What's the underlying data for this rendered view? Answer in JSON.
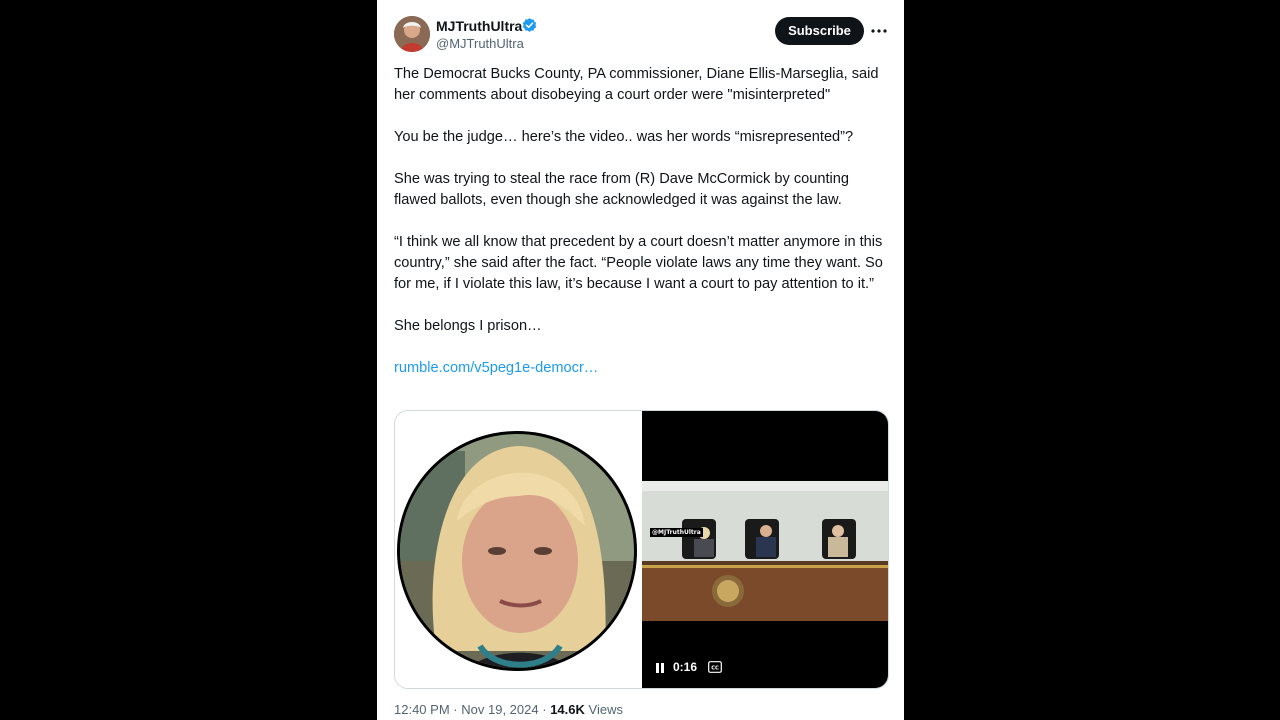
{
  "author": {
    "name": "MJTruthUltra",
    "handle": "@MJTruthUltra",
    "verified": true,
    "verified_color": "#1d9bf0"
  },
  "header": {
    "subscribe_label": "Subscribe",
    "more_icon": "more-horizontal-icon"
  },
  "tweet": {
    "paragraphs": [
      "The Democrat Bucks County, PA commissioner, Diane Ellis-Marseglia, said her comments about disobeying a court order were \"misinterpreted\"",
      "You be the judge… here’s the video.. was her words “misrepresented”?",
      "She was trying to steal the race from (R) Dave McCormick by counting flawed ballots, even though she acknowledged it was against the law.",
      "“I think we all know that precedent by a court doesn’t matter anymore in this country,” she said after the fact. “People violate laws any time they want. So for me, if I violate this law, it’s because I want a court to pay attention to it.”",
      "She belongs I prison…"
    ],
    "link": "rumble.com/v5peg1e-democr…"
  },
  "media": {
    "video_time": "0:16",
    "watermark": "@MJTruthUltra",
    "pause_icon": "pause-icon",
    "cc_icon": "closed-captions-icon"
  },
  "meta": {
    "time": "12:40 PM",
    "separator": "·",
    "date": "Nov 19, 2024",
    "views_count": "14.6K",
    "views_label": "Views"
  },
  "colors": {
    "link": "#1d9bf0",
    "text": "#0f1419",
    "secondary": "#536471",
    "background": "#000000",
    "card": "#ffffff"
  }
}
